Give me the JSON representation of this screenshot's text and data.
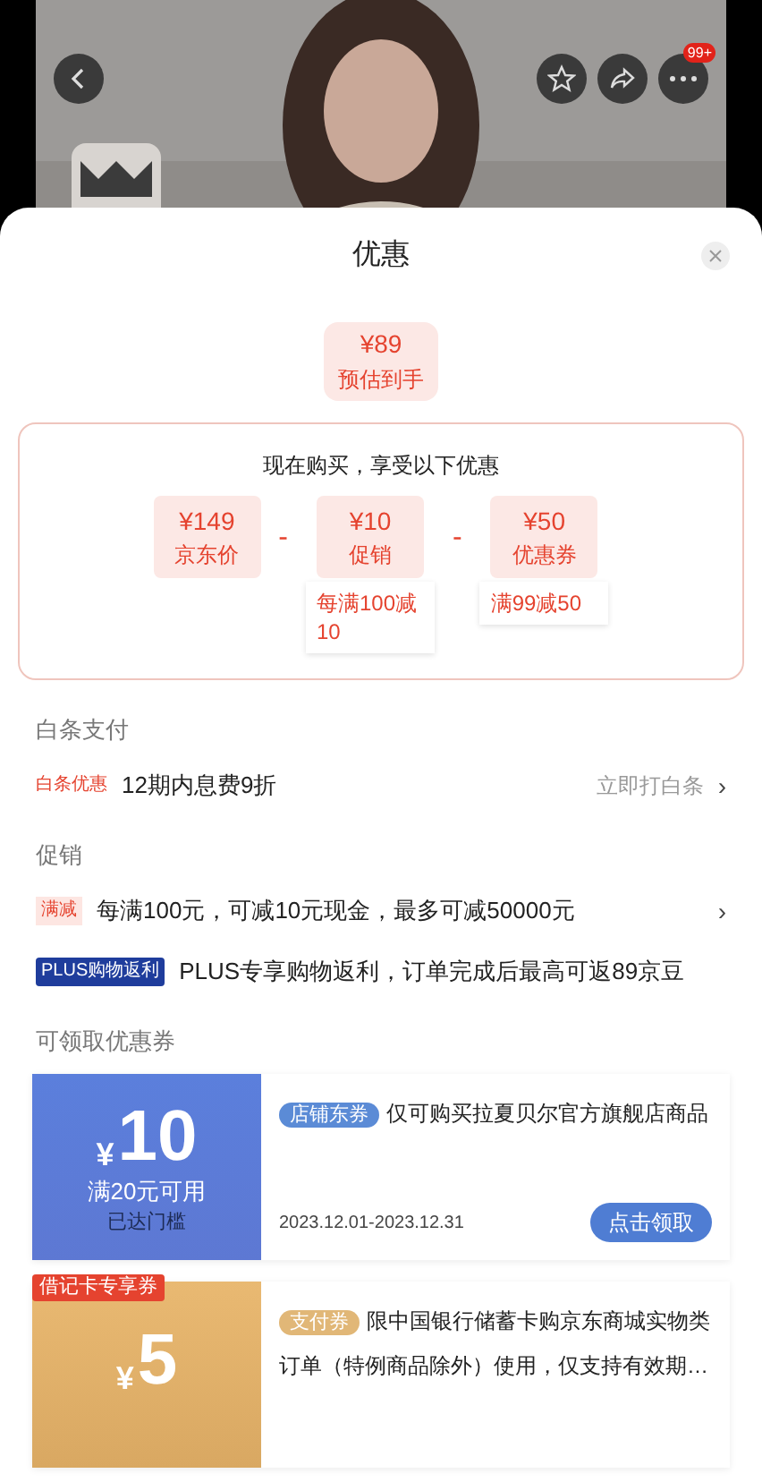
{
  "header": {
    "badge": "99+"
  },
  "sheet": {
    "title": "优惠",
    "estimate": {
      "price": "¥89",
      "label": "预估到手"
    },
    "breakdown": {
      "heading": "现在购买，享受以下优惠",
      "items": [
        {
          "kind": "price",
          "amount": "¥149",
          "label": "京东价"
        },
        {
          "kind": "operator",
          "symbol": "-"
        },
        {
          "kind": "price",
          "amount": "¥10",
          "label": "促销",
          "note": "每满100减10"
        },
        {
          "kind": "operator",
          "symbol": "-"
        },
        {
          "kind": "price",
          "amount": "¥50",
          "label": "优惠券",
          "note": "满99减50"
        }
      ]
    },
    "sections": [
      {
        "title": "白条支付",
        "rows": [
          {
            "kind": "baitiao",
            "tag": "白条优惠",
            "text": "12期内息费9折",
            "action": "立即打白条",
            "arrow": "›"
          }
        ]
      },
      {
        "title": "促销",
        "rows": [
          {
            "kind": "manjian",
            "tag": "满减",
            "text": "每满100元，可减10元现金，最多可减50000元",
            "arrow": "›"
          },
          {
            "kind": "plus",
            "tag": "PLUS购物返利",
            "text": "PLUS专享购物返利，订单完成后最高可返89京豆"
          }
        ]
      },
      {
        "title": "可领取优惠券",
        "coupons": [
          {
            "kind": "store",
            "amount": "10",
            "currency": "¥",
            "condition": "满20元可用",
            "status": "已达门槛",
            "tag": "店铺东券",
            "text": "仅可购买拉夏贝尔官方旗舰店商品",
            "date": "2023.12.01-2023.12.31",
            "button": "点击领取"
          },
          {
            "kind": "payment",
            "amount": "5",
            "currency": "¥",
            "ribbon": "借记卡专享券",
            "tag": "支付券",
            "text": "限中国银行储蓄卡购京东商城实物类订单（特例商品除外）使用，仅支持有效期…"
          }
        ]
      }
    ]
  }
}
